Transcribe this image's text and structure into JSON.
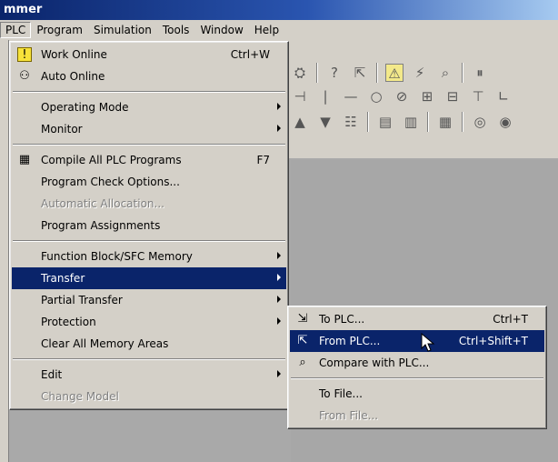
{
  "titlebar": {
    "title": "mmer"
  },
  "menubar": {
    "items": [
      "PLC",
      "Program",
      "Simulation",
      "Tools",
      "Window",
      "Help"
    ]
  },
  "plc_menu": {
    "items": [
      {
        "label": "Work Online",
        "shortcut": "Ctrl+W",
        "icon": "warning-online-icon"
      },
      {
        "label": "Auto Online",
        "shortcut": "",
        "icon": "binoculars-online-icon"
      },
      {
        "label": "Operating Mode",
        "shortcut": "",
        "submenu": true
      },
      {
        "label": "Monitor",
        "shortcut": "",
        "submenu": true
      },
      {
        "label": "Compile All PLC Programs",
        "shortcut": "F7",
        "icon": "compile-icon"
      },
      {
        "label": "Program Check Options...",
        "shortcut": ""
      },
      {
        "label": "Automatic Allocation...",
        "shortcut": "",
        "disabled": true
      },
      {
        "label": "Program Assignments",
        "shortcut": ""
      },
      {
        "label": "Function Block/SFC Memory",
        "shortcut": "",
        "submenu": true
      },
      {
        "label": "Transfer",
        "shortcut": "",
        "submenu": true,
        "selected": true
      },
      {
        "label": "Partial Transfer",
        "shortcut": "",
        "submenu": true
      },
      {
        "label": "Protection",
        "shortcut": "",
        "submenu": true
      },
      {
        "label": "Clear All Memory Areas",
        "shortcut": ""
      },
      {
        "label": "Edit",
        "shortcut": "",
        "submenu": true
      },
      {
        "label": "Change Model",
        "shortcut": "",
        "disabled": true
      }
    ]
  },
  "transfer_menu": {
    "items": [
      {
        "label": "To PLC...",
        "shortcut": "Ctrl+T",
        "icon": "to-plc-icon"
      },
      {
        "label": "From PLC...",
        "shortcut": "Ctrl+Shift+T",
        "icon": "from-plc-icon",
        "selected": true
      },
      {
        "label": "Compare with PLC...",
        "shortcut": "",
        "icon": "compare-icon"
      },
      {
        "label": "To File...",
        "shortcut": ""
      },
      {
        "label": "From File...",
        "shortcut": "",
        "disabled": true
      }
    ]
  },
  "colors": {
    "highlight": "#0a246a",
    "menu_bg": "#d4d0c8",
    "workspace": "#a7a7a7"
  }
}
